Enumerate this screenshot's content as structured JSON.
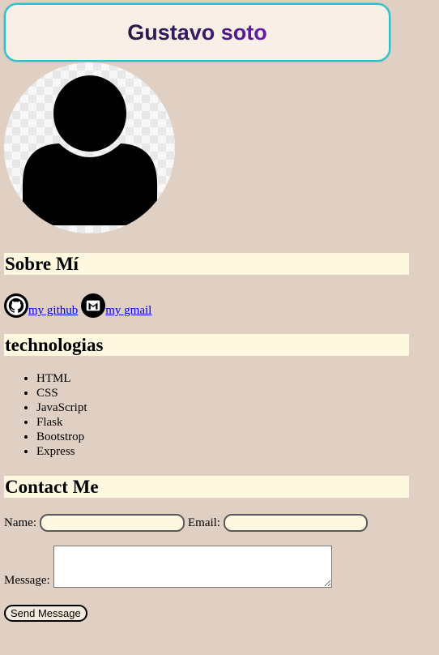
{
  "header": {
    "title": "Gustavo soto"
  },
  "sections": {
    "about": "Sobre Mí",
    "technologies": "technologias",
    "contact": "Contact Me"
  },
  "links": [
    {
      "label": "my github",
      "icon": "github-icon"
    },
    {
      "label": "my gmail",
      "icon": "gmail-icon"
    }
  ],
  "tech_list": [
    "HTML",
    "CSS",
    "JavaScript",
    "Flask",
    "Bootstrop",
    "Express"
  ],
  "form": {
    "name_label": "Name:",
    "name_value": "",
    "email_label": "Email:",
    "email_value": "",
    "message_label": "Message:",
    "message_value": "",
    "send_label": "Send Message"
  },
  "colors": {
    "page_bg": "#dfd0c3",
    "title_border": "#23c3cf",
    "heading_bg": "#fdf8df",
    "link": "#0000ee"
  }
}
